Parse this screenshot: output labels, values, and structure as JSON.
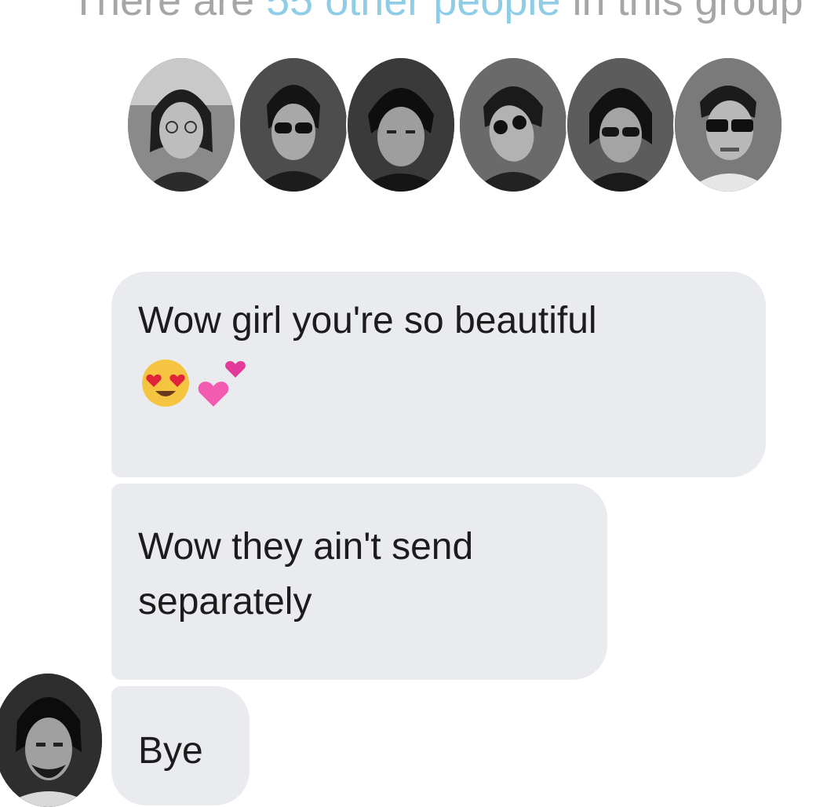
{
  "header": {
    "text_prefix": "There are ",
    "link_text": "55 other people",
    "text_suffix": " in this group"
  },
  "members": [
    {
      "icon": "member-avatar-1",
      "tone": "#6b6b6b"
    },
    {
      "icon": "member-avatar-2",
      "tone": "#555555"
    },
    {
      "icon": "member-avatar-3",
      "tone": "#4a4a4a"
    },
    {
      "icon": "member-avatar-4",
      "tone": "#606060"
    },
    {
      "icon": "member-avatar-5",
      "tone": "#5a5a5a"
    },
    {
      "icon": "member-avatar-6",
      "tone": "#777777"
    }
  ],
  "messages": [
    {
      "text": "Wow girl you're so beautiful",
      "emojis": [
        "heart-eyes-emoji",
        "two-hearts-emoji"
      ]
    },
    {
      "text_line1": "Wow they ain't send",
      "text_line2": "separately"
    },
    {
      "text": "Bye"
    }
  ],
  "colors": {
    "bubble": "#e9ebef",
    "text": "#1c1c1c",
    "header_gray": "#a6a6a6",
    "header_link": "#8fcde6"
  }
}
